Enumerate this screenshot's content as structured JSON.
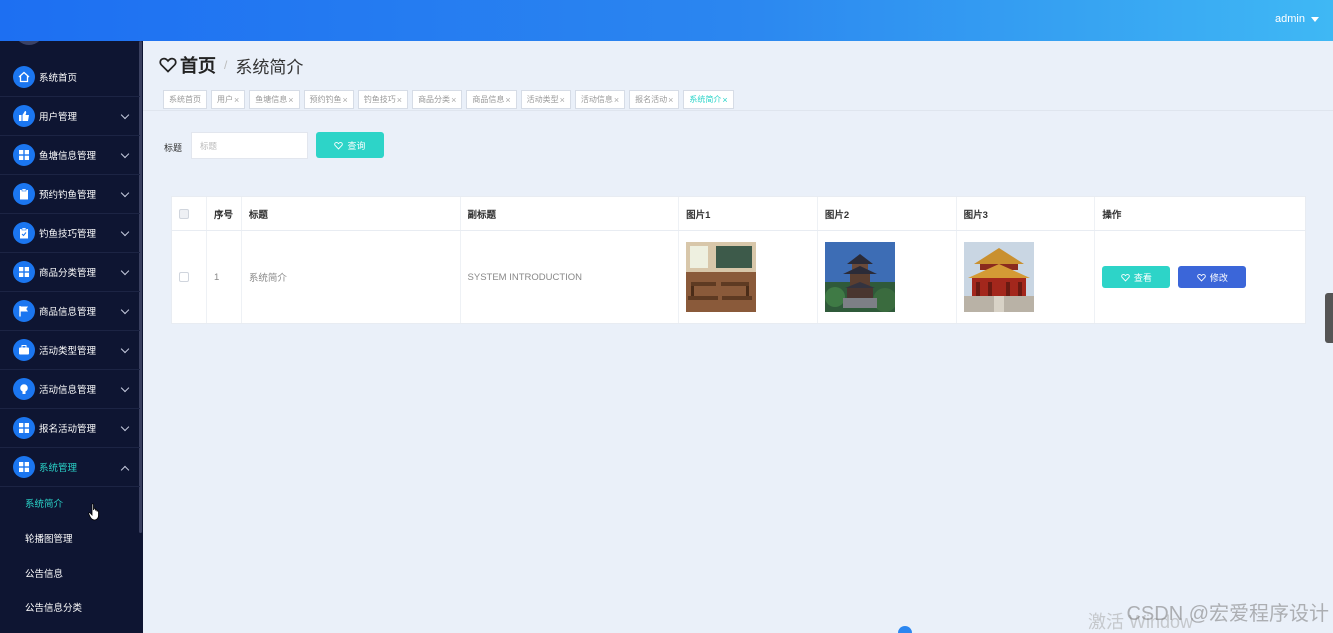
{
  "header": {
    "user": "admin"
  },
  "sidebar": {
    "items": [
      {
        "label": "系统首页",
        "icon": "home-icon"
      },
      {
        "label": "用户管理",
        "icon": "thumb-up-icon"
      },
      {
        "label": "鱼塘信息管理",
        "icon": "grid-icon"
      },
      {
        "label": "预约钓鱼管理",
        "icon": "clipboard-icon"
      },
      {
        "label": "钓鱼技巧管理",
        "icon": "clipboard-icon"
      },
      {
        "label": "商品分类管理",
        "icon": "grid-icon"
      },
      {
        "label": "商品信息管理",
        "icon": "flag-icon"
      },
      {
        "label": "活动类型管理",
        "icon": "briefcase-icon"
      },
      {
        "label": "活动信息管理",
        "icon": "bulb-icon"
      },
      {
        "label": "报名活动管理",
        "icon": "grid-icon"
      },
      {
        "label": "系统管理",
        "icon": "grid-icon"
      }
    ],
    "sub_items": [
      {
        "label": "系统简介"
      },
      {
        "label": "轮播图管理"
      },
      {
        "label": "公告信息"
      },
      {
        "label": "公告信息分类"
      }
    ]
  },
  "breadcrumb": {
    "home": "首页",
    "separator": "/",
    "current": "系统简介"
  },
  "tabs": [
    {
      "label": "系统首页",
      "closable": false
    },
    {
      "label": "用户",
      "closable": true
    },
    {
      "label": "鱼塘信息",
      "closable": true
    },
    {
      "label": "预约钓鱼",
      "closable": true
    },
    {
      "label": "钓鱼技巧",
      "closable": true
    },
    {
      "label": "商品分类",
      "closable": true
    },
    {
      "label": "商品信息",
      "closable": true
    },
    {
      "label": "活动类型",
      "closable": true
    },
    {
      "label": "活动信息",
      "closable": true
    },
    {
      "label": "报名活动",
      "closable": true
    },
    {
      "label": "系统简介",
      "closable": true
    }
  ],
  "search": {
    "label": "标题",
    "placeholder": "标题",
    "button": "查询"
  },
  "table": {
    "headers": [
      "",
      "序号",
      "标题",
      "副标题",
      "图片1",
      "图片2",
      "图片3",
      "操作"
    ],
    "rows": [
      {
        "index": "1",
        "title": "系统简介",
        "subtitle": "SYSTEM INTRODUCTION",
        "view": "查看",
        "edit": "修改"
      }
    ]
  },
  "overlay": {
    "watermark": "CSDN @宏爱程序设计",
    "os_hint": "激活 Window"
  },
  "colors": {
    "accent": "#2dd4c8",
    "primary": "#3b66d9",
    "sidebar_bg": "#0e1532",
    "topbar": "#1d6ff2"
  }
}
